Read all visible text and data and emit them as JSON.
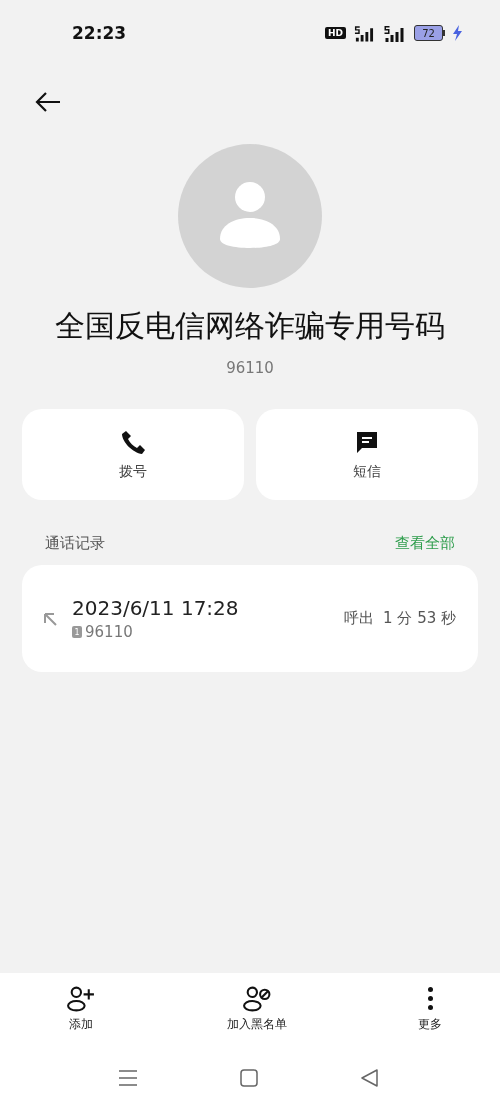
{
  "status_bar": {
    "time": "22:23",
    "hd_badge": "HD",
    "battery": "72",
    "charging": true
  },
  "contact": {
    "name": "全国反电信网络诈骗专用号码",
    "number": "96110"
  },
  "actions": [
    {
      "kind": "call",
      "label": "拨号"
    },
    {
      "kind": "message",
      "label": "短信"
    }
  ],
  "call_log": {
    "title": "通话记录",
    "view_all": "查看全部",
    "entries": [
      {
        "kind": "outgoing",
        "datetime": "2023/6/11 17:28",
        "sim": "1",
        "number": "96110",
        "summary": "呼出  1 分 53 秒"
      }
    ]
  },
  "bottom_actions": [
    {
      "kind": "add",
      "label": "添加"
    },
    {
      "kind": "block",
      "label": "加入黑名单"
    },
    {
      "kind": "more",
      "label": "更多"
    }
  ]
}
